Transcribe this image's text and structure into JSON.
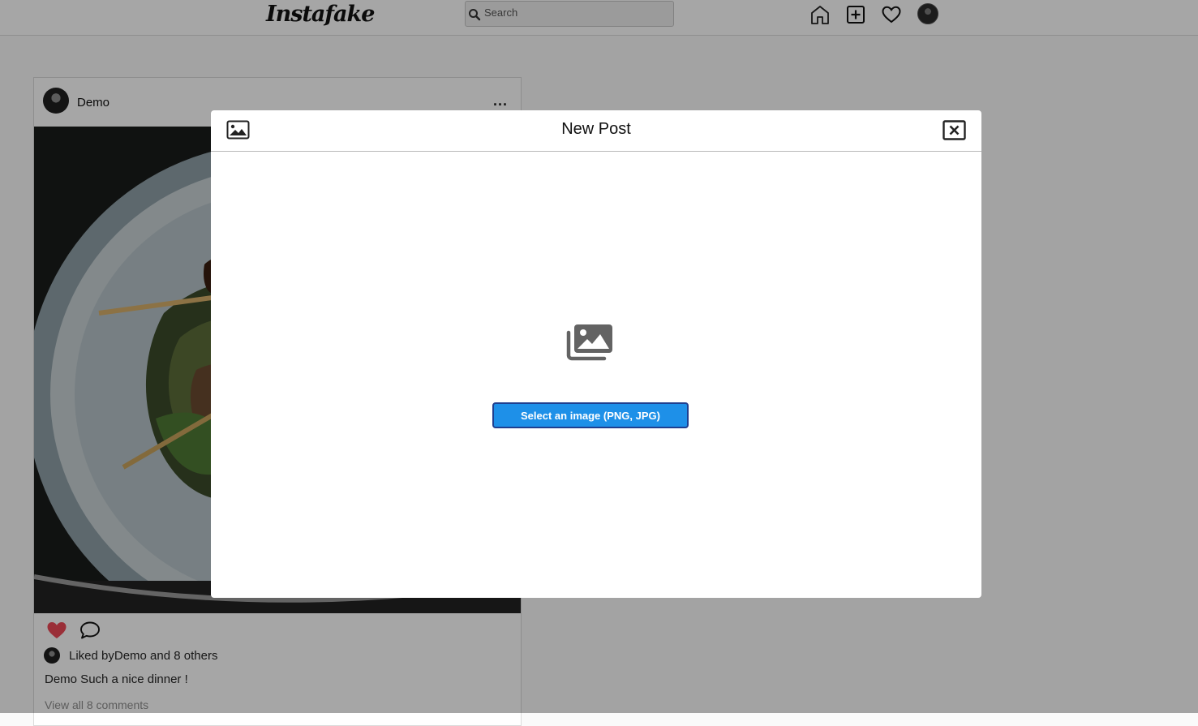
{
  "nav": {
    "logo": "Instafake",
    "search_placeholder": "Search",
    "icons": [
      "home-icon",
      "new-post-icon",
      "heart-icon",
      "profile-avatar"
    ]
  },
  "post": {
    "username": "Demo",
    "more_label": "...",
    "likes": {
      "prefix": "Liked by ",
      "user": "Demo",
      "middle": " and ",
      "others": "8 others"
    },
    "caption_user": "Demo",
    "caption_text": " Such a nice dinner !",
    "view_comments": "View all 8 comments",
    "liked": true,
    "like_color": "#ed4956"
  },
  "modal": {
    "title": "New Post",
    "select_button": "Select an image (PNG, JPG)",
    "button_color": "#1e90e8"
  }
}
